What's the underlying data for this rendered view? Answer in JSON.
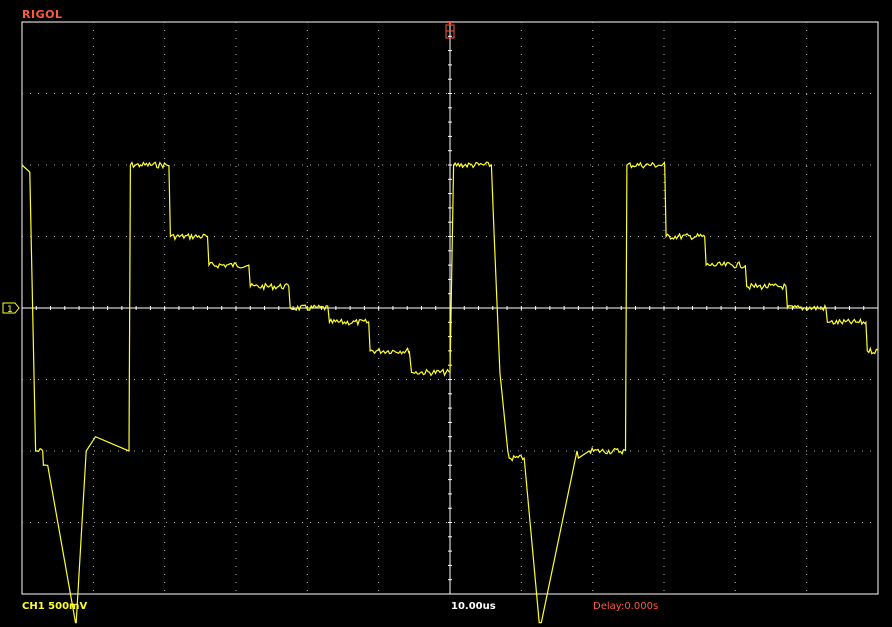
{
  "brand": "RIGOL",
  "status": {
    "channel_scale": "CH1 500mV",
    "timebase": "10.00us",
    "delay": "Delay:0.000s"
  },
  "markers": {
    "ground_marker_label": "1"
  },
  "colors": {
    "trace": "#ffff2a",
    "grid_border": "#ffffff",
    "grid_dots": "#b8b8b8",
    "brand": "#ff5a3c",
    "background": "#000000"
  },
  "chart_data": {
    "type": "line",
    "xlim": [
      0,
      120
    ],
    "ylim": [
      -2000,
      2000
    ],
    "x_unit": "us",
    "y_unit": "mV",
    "series": [
      {
        "x": [
          0,
          1.1,
          1.7,
          1.9,
          2.9,
          3.0,
          3.6,
          7.5,
          7.6,
          9.0,
          10.3,
          15.0,
          15.2,
          16.6,
          20.6,
          20.8,
          26.0,
          26.2,
          31.8,
          32.0,
          37.4,
          37.6,
          42.9,
          43.1,
          48.6,
          48.8,
          54.3,
          54.6,
          60.0,
          60.5,
          65.8,
          66.2,
          67.0,
          68.1,
          68.3,
          70.4,
          72.5,
          72.8,
          77.8,
          78.0,
          79.5,
          84.6,
          84.8,
          90.1,
          90.3,
          95.7,
          95.9,
          101.4,
          101.6,
          107.1,
          107.3,
          112.7,
          112.9,
          118.3,
          118.5,
          120.0
        ],
        "y": [
          1000,
          950,
          -500,
          -1000,
          -1000,
          -1100,
          -1100,
          -2200,
          -2200,
          -1000,
          -900,
          -1000,
          1000,
          1000,
          1000,
          500,
          500,
          300,
          300,
          150,
          150,
          0,
          0,
          -100,
          -100,
          -300,
          -300,
          -450,
          -450,
          1000,
          1000,
          500,
          -450,
          -1000,
          -1050,
          -1050,
          -2200,
          -2200,
          -1000,
          -1050,
          -1000,
          -1000,
          1000,
          1000,
          500,
          500,
          300,
          300,
          150,
          150,
          0,
          0,
          -100,
          -100,
          -300,
          -300
        ]
      }
    ]
  }
}
